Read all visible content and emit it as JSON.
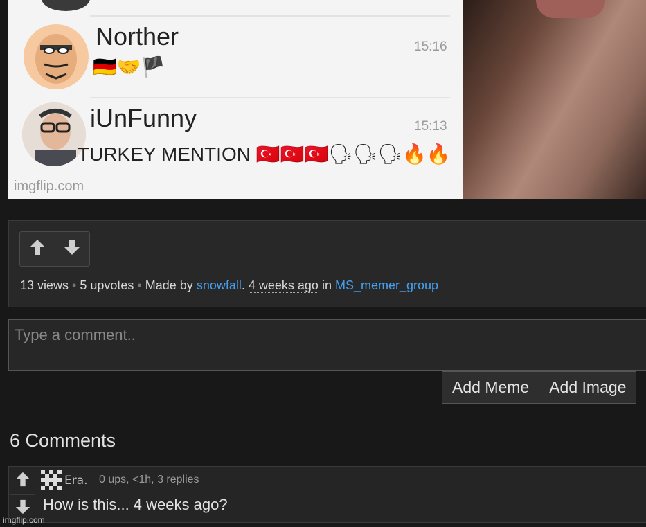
{
  "meme": {
    "chat1": {
      "name": "Norther",
      "time": "15:16",
      "message": "🇩🇪🤝🏴"
    },
    "chat2": {
      "name": "iUnFunny",
      "time": "15:13",
      "message": "TURKEY MENTION 🇹🇷🇹🇷🇹🇷🗣🗣🗣🔥🔥"
    },
    "watermark": "imgflip.com"
  },
  "post": {
    "views": "13 views",
    "upvotes": "5 upvotes",
    "made_by_prefix": "Made by",
    "author": "snowfall",
    "time": "4 weeks ago",
    "in_word": "in",
    "stream": "MS_memer_group"
  },
  "comment_box": {
    "placeholder": "Type a comment..",
    "add_meme": "Add Meme",
    "add_image": "Add Image"
  },
  "comments": {
    "count_label": "6 Comments",
    "items": [
      {
        "user": "Era.",
        "meta": "0 ups, <1h, 3 replies",
        "text": "How is this... 4 weeks ago?"
      }
    ]
  },
  "footer": {
    "watermark": "imgflip.com"
  }
}
